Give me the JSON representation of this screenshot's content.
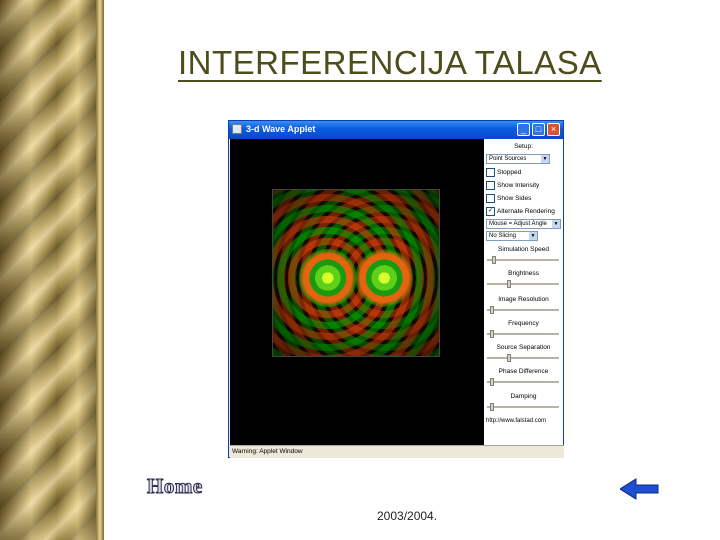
{
  "slide": {
    "title": "INTERFERENCIJA TALASA",
    "footer": "2003/2004.",
    "home_label": "Home"
  },
  "window": {
    "title": "3-d Wave Applet",
    "min_glyph": "_",
    "max_glyph": "□",
    "close_glyph": "×",
    "status": "Warning: Applet Window"
  },
  "panel": {
    "setup_label": "Setup:",
    "setup_select": "Point Sources",
    "checkboxes": [
      {
        "label": "Stopped",
        "checked": false
      },
      {
        "label": "Show Intensity",
        "checked": false
      },
      {
        "label": "Show Sides",
        "checked": false
      },
      {
        "label": "Alternate Rendering",
        "checked": true
      }
    ],
    "mouse_select": "Mouse = Adjust Angle",
    "slicing_select": "No Slicing",
    "sliders": [
      {
        "label": "Simulation Speed",
        "value": 0.08
      },
      {
        "label": "Brightness",
        "value": 0.3
      },
      {
        "label": "Image Resolution",
        "value": 0.05
      },
      {
        "label": "Frequency",
        "value": 0.05
      },
      {
        "label": "Source Separation",
        "value": 0.3
      },
      {
        "label": "Phase Difference",
        "value": 0.05
      },
      {
        "label": "Damping",
        "value": 0.05
      }
    ],
    "link": "http://www.falstad.com"
  },
  "colors": {
    "title": "#4e4d1c",
    "arrow": "#1e4fd0",
    "xp_blue": "#0a5fe0"
  },
  "icons": {
    "back": "left-arrow-icon",
    "window": "applet-window-icon"
  }
}
